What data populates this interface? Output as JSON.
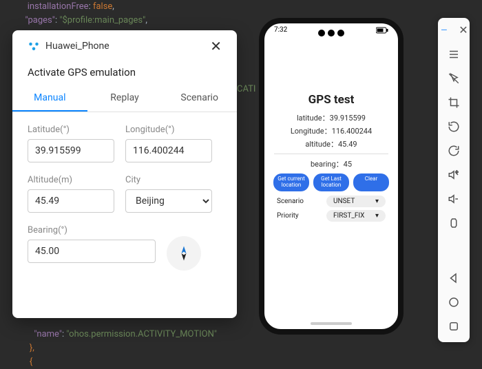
{
  "code": {
    "l1a": "installationFree",
    "l1b": ": ",
    "l1c": "false",
    "l1d": ",",
    "l2a": "\"pages\"",
    "l2b": ": ",
    "l2c": "\"$profile:main_pages\"",
    "l2d": ",",
    "l3": "CATI",
    "l30a": "\"name\"",
    "l30b": ": ",
    "l30c": "\"ohos.permission.ACTIVITY_MOTION\"",
    "l31": "},",
    "l32": "{"
  },
  "dialog": {
    "device": "Huawei_Phone",
    "heading": "Activate GPS emulation",
    "tabs": {
      "manual": "Manual",
      "replay": "Replay",
      "scenario": "Scenario"
    },
    "lat_label": "Latitude(°)",
    "lat": "39.915599",
    "lon_label": "Longitude(°)",
    "lon": "116.400244",
    "alt_label": "Altitude(m)",
    "alt": "45.49",
    "city_label": "City",
    "city": "Beijing",
    "brg_label": "Bearing(°)",
    "brg": "45.00"
  },
  "emu": {
    "time": "7:32",
    "title": "GPS test",
    "lat": "latitude：39.915599",
    "lon": "Longitude：116.400244",
    "alt": "altitude：45.49",
    "brg": "bearing：45",
    "btn1": "Get current location",
    "btn2": "Get Last location",
    "btn3": "Clear",
    "row1_label": "Scenario",
    "row1_val": "UNSET",
    "row2_label": "Priority",
    "row2_val": "FIRST_FIX"
  }
}
